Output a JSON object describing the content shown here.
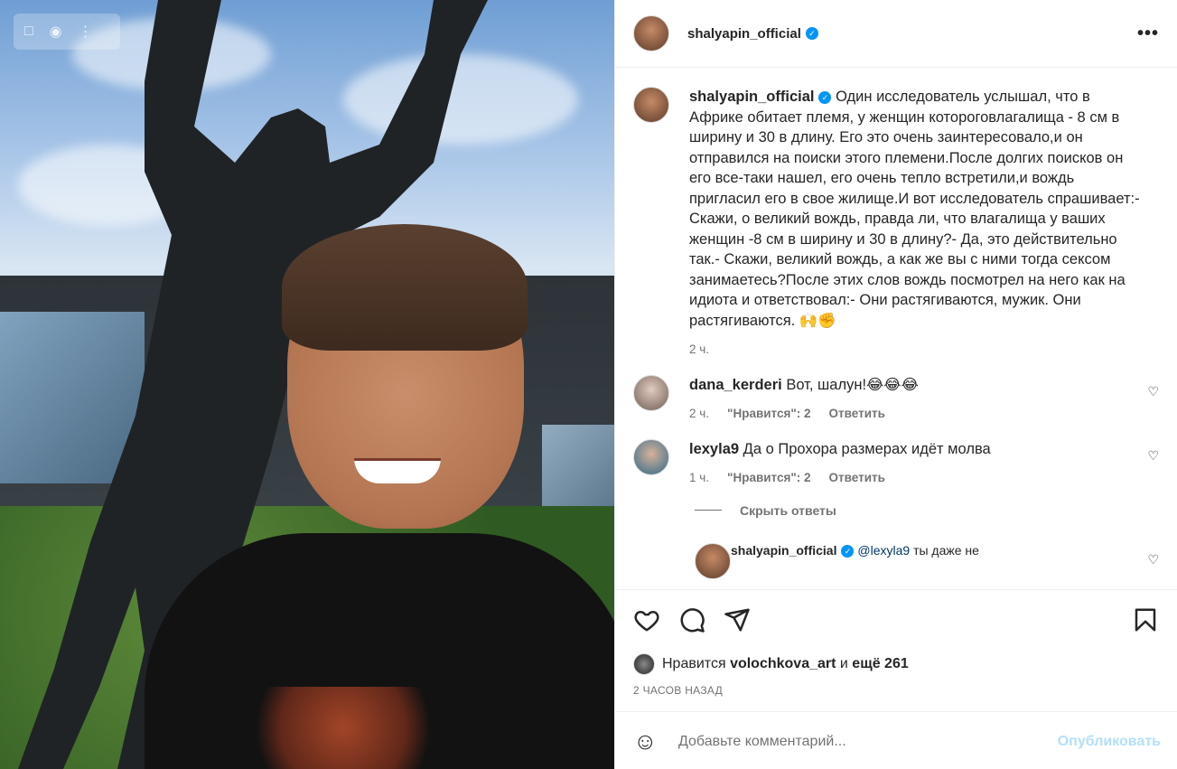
{
  "post": {
    "author": "shalyapin_official",
    "verified_icon": "verified-badge-icon",
    "more_icon": "more-horizontal-icon"
  },
  "photo_tools": {
    "bookmark_icon": "bookmark-icon",
    "camera_icon": "camera-icon",
    "more_icon": "more-vertical-icon"
  },
  "caption": {
    "author": "shalyapin_official",
    "text": "Один исследователь услышал, что в Африке обитает племя, у женщин котороговлагалища - 8 см в ширину и 30 в длину. Его это очень заинтересовало,и он отправился на поиски этого племени.После долгих поисков он его все-таки нашел, его очень тепло встретили,и вождь пригласил его в свое жилище.И вот исследователь спрашивает:- Скажи, о великий вождь, правда ли, что влагалища у ваших женщин -8 см в ширину и 30 в длину?- Да, это действительно так.- Скажи, великий вождь, а как же вы с ними тогда сексом занимаетесь?После этих слов вождь посмотрел на него как на идиота и ответствовал:- Они растягиваются, мужик. Они растягиваются. 🙌✊",
    "time": "2 ч."
  },
  "comments": [
    {
      "author": "dana_kerderi",
      "text": "Вот, шалун!😂😂😂",
      "time": "2 ч.",
      "likes": "\"Нравится\": 2",
      "reply": "Ответить"
    },
    {
      "author": "lexyla9",
      "text": "Да о Прохора размерах идёт молва",
      "time": "1 ч.",
      "likes": "\"Нравится\": 2",
      "reply": "Ответить"
    }
  ],
  "hide_replies": "Скрыть ответы",
  "reply_comment": {
    "author": "shalyapin_official",
    "mention": "@lexyla9",
    "text": "ты даже не"
  },
  "actions": {
    "like_icon": "heart-icon",
    "comment_icon": "comment-icon",
    "share_icon": "share-icon",
    "save_icon": "bookmark-icon"
  },
  "likes": {
    "prefix": "Нравится",
    "user": "volochkova_art",
    "conj": "и",
    "others": "ещё 261"
  },
  "posted_time": "2 ЧАСОВ НАЗАД",
  "add_comment": {
    "emoji_icon": "emoji-icon",
    "placeholder": "Добавьте комментарий...",
    "publish": "Опубликовать"
  },
  "colors": {
    "accent": "#0095f6",
    "publish_disabled": "#b2dffc",
    "secondary_text": "#737373",
    "link": "#00376b"
  }
}
